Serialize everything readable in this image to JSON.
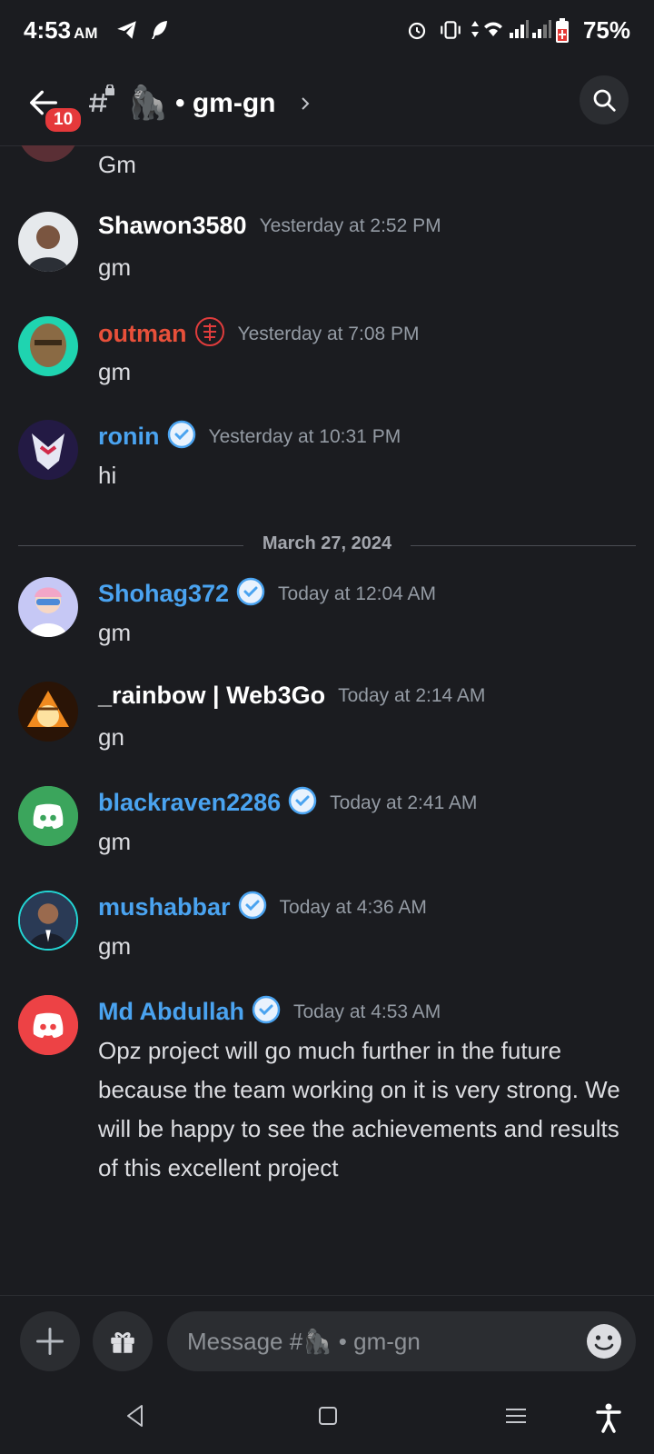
{
  "status_bar": {
    "time": "4:53",
    "ampm": "AM",
    "battery": "75%",
    "icons": [
      "telegram-icon",
      "feather-icon",
      "alarm-icon",
      "vibrate-icon",
      "data-icon",
      "wifi-icon",
      "signal-icon",
      "signal-icon-2",
      "battery-icon"
    ]
  },
  "header": {
    "unread_badge": "10",
    "emoji": "🦍",
    "channel": "• gm-gn"
  },
  "messages": [
    {
      "author": "",
      "timestamp": "",
      "text": "Gm",
      "avatar_color": "#6b3b3b"
    },
    {
      "author": "Shawon3580",
      "timestamp": "Yesterday at 2:52 PM",
      "text": "gm",
      "name_color": "#ffffff",
      "avatar_color": "#5d6d7a"
    },
    {
      "author": "outman",
      "timestamp": "Yesterday at 7:08 PM",
      "text": "gm",
      "name_color": "#e8503a",
      "avatar_color": "#1fd4b0"
    },
    {
      "author": "ronin",
      "timestamp": "Yesterday at 10:31 PM",
      "text": "hi",
      "name_color": "#4aa3f0",
      "avatar_color": "#3a2f6b"
    },
    {
      "author": "Shohag372",
      "timestamp": "Today at 12:04 AM",
      "text": "gm",
      "name_color": "#4aa3f0",
      "avatar_color": "#c6c8f5"
    },
    {
      "author": "_rainbow | Web3Go",
      "timestamp": "Today at 2:14 AM",
      "text": "gn",
      "name_color": "#ffffff",
      "avatar_color": "#d2761f"
    },
    {
      "author": "blackraven2286",
      "timestamp": "Today at 2:41 AM",
      "text": "gm",
      "name_color": "#4aa3f0",
      "avatar_color": "#3ba55c"
    },
    {
      "author": "mushabbar",
      "timestamp": "Today at 4:36 AM",
      "text": "gm",
      "name_color": "#4aa3f0",
      "avatar_color": "#2a3a55"
    },
    {
      "author": "Md Abdullah",
      "timestamp": "Today at 4:53 AM",
      "text": "Opz project will go much further in the future because the team working on it is very strong. We will be happy to see the achievements and results of this excellent project",
      "name_color": "#4aa3f0",
      "avatar_color": "#ed4245"
    }
  ],
  "date_divider": "March 27, 2024",
  "composer": {
    "placeholder": "Message #🦍 • gm-gn"
  },
  "colors": {
    "background": "#1b1c20",
    "surface": "#2b2d31",
    "accent_blue": "#4aa3f0",
    "badge_red": "#e5393b",
    "muted": "#949ba4"
  }
}
